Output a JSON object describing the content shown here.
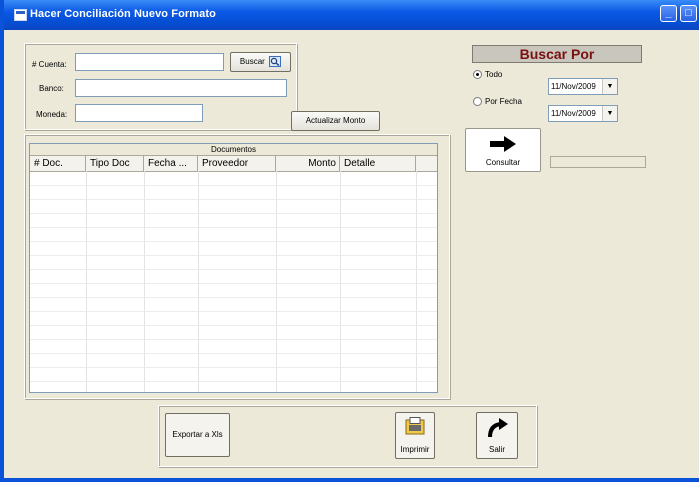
{
  "window": {
    "title": "Hacer Conciliación Nuevo Formato"
  },
  "form": {
    "cuenta_label": "# Cuenta:",
    "banco_label": "Banco:",
    "moneda_label": "Moneda:",
    "cuenta_value": "",
    "banco_value": "",
    "moneda_value": "",
    "buscar_button": "Buscar",
    "actualizar_button": "Actualizar Monto"
  },
  "search": {
    "title": "Buscar Por",
    "option_todo": "Todo",
    "option_fecha": "Por Fecha",
    "selected": "Todo",
    "date_from": "11/Nov/2009",
    "date_to": "11/Nov/2009",
    "consultar_button": "Consultar",
    "status_value": ""
  },
  "grid": {
    "caption": "Documentos",
    "columns": [
      "# Doc.",
      "Tipo Doc",
      "Fecha ...",
      "Proveedor",
      "Monto",
      "Detalle"
    ],
    "rows": []
  },
  "footer": {
    "export_button": "Exportar a Xls",
    "print_button": "Imprimir",
    "exit_button": "Salir"
  },
  "colors": {
    "titlebar": "#0a58e4",
    "face": "#ece9d8",
    "search_title": "#7b1010"
  },
  "icons": [
    "window-app-icon",
    "minimize-icon",
    "maximize-icon",
    "close-icon",
    "search-icon",
    "arrow-right-icon",
    "printer-icon",
    "exit-arrow-icon"
  ]
}
